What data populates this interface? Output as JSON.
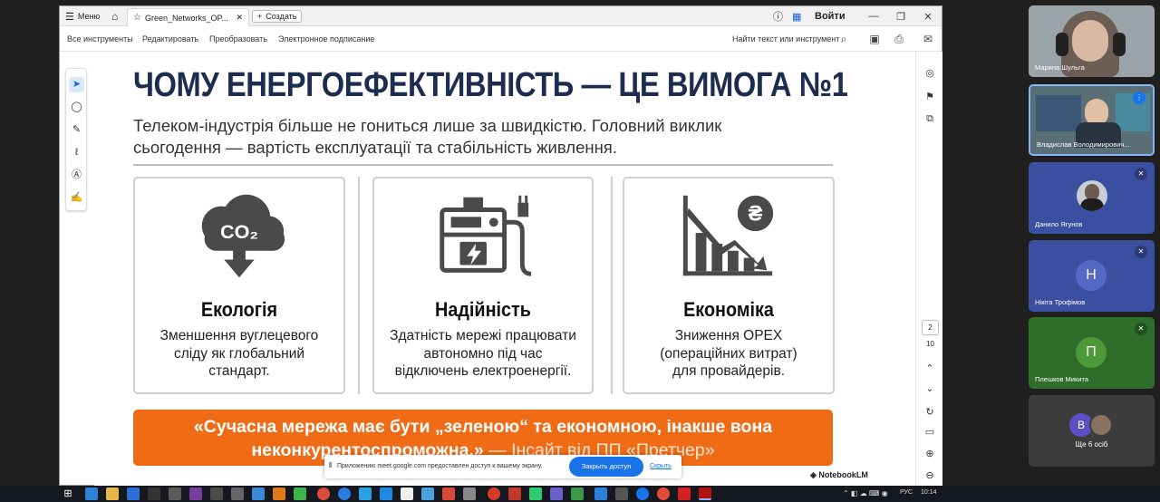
{
  "acrobat": {
    "menu_label": "Меню",
    "tab_title": "Green_Networks_OP...",
    "create_label": "Создать",
    "login_label": "Войти",
    "toolbar_items": [
      "Все инструменты",
      "Редактировать",
      "Преобразовать",
      "Электронное подписание"
    ],
    "find_label": "Найти текст или инструмент"
  },
  "slide": {
    "title": "ЧОМУ ЕНЕРГОЕФЕКТИВНІСТЬ — ЦЕ ВИМОГА №1",
    "subtitle_line1": "Телеком-індустрія більше не гониться лише за швидкістю. Головний виклик",
    "subtitle_line2": "сьогодення — вартість експлуатації та стабільність живлення.",
    "cards": [
      {
        "title": "Екологія",
        "lines": [
          "Зменшення вуглецевого",
          "сліду як глобальний",
          "стандарт."
        ],
        "icon": "co2-cloud-icon",
        "icon_text": "CO₂"
      },
      {
        "title": "Надійність",
        "lines": [
          "Здатність мережі працювати",
          "автономно під час",
          "відключень електроенергії."
        ],
        "icon": "generator-icon"
      },
      {
        "title": "Економіка",
        "lines": [
          "Зниження OPEX",
          "(операційних витрат)",
          "для провайдерів."
        ],
        "icon": "declining-chart-icon",
        "icon_text": "₴"
      }
    ],
    "quote_line1": "«Сучасна мережа має бути „зеленою“ та економною, інакше вона",
    "quote_line2": "неконкурентоспроможна.»",
    "quote_source": " — Інсайт від ПП «Претчер»",
    "watermark": "NotebookLM",
    "colors": {
      "title": "#1c2d4f",
      "quote_bg": "#ef6b16",
      "icon": "#4a4a4a"
    }
  },
  "page_nav": {
    "current": "2",
    "total": "10"
  },
  "share_bar": {
    "text": "Приложению meet.google.com предоставлен доступ к вашему экрану.",
    "button": "Закрыть доступ",
    "hide": "Скрыть"
  },
  "participants": [
    {
      "name": "Марина Шульга",
      "type": "video",
      "color": "#9aa3a8"
    },
    {
      "name": "Владислав Володимирович...",
      "type": "video",
      "color": "#6d8a96"
    },
    {
      "name": "Данило Ягунов",
      "type": "photo",
      "color": "#3a4fa0"
    },
    {
      "name": "Нікіта Трофімов",
      "type": "letter",
      "letter": "Н",
      "color": "#3a4fa0",
      "avatar_color": "#5469c4"
    },
    {
      "name": "Плешков Микита",
      "type": "letter",
      "letter": "П",
      "color": "#2e6e2a",
      "avatar_color": "#4e9a3a"
    },
    {
      "name": "Ще 6 осіб",
      "type": "more",
      "letter": "В",
      "color": "#3c3c3c",
      "avatar_color": "#5b4fc4"
    }
  ],
  "taskbar": {
    "lang": "РУС",
    "time": "10:14"
  }
}
